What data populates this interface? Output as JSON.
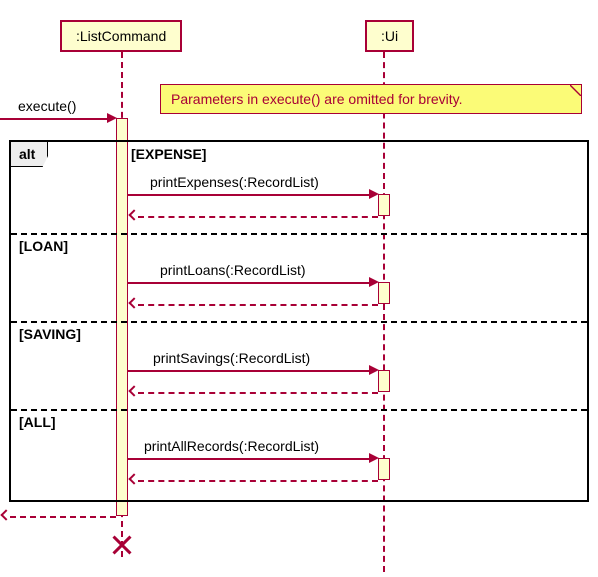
{
  "participants": {
    "listCommand": ":ListCommand",
    "ui": ":Ui"
  },
  "incoming": {
    "execute": "execute()"
  },
  "note": "Parameters in execute() are omitted for brevity.",
  "frame": {
    "operator": "alt",
    "branches": {
      "expense": {
        "guard": "[EXPENSE]",
        "msg": "printExpenses(:RecordList)"
      },
      "loan": {
        "guard": "[LOAN]",
        "msg": "printLoans(:RecordList)"
      },
      "saving": {
        "guard": "[SAVING]",
        "msg": "printSavings(:RecordList)"
      },
      "all": {
        "guard": "[ALL]",
        "msg": "printAllRecords(:RecordList)"
      }
    }
  }
}
